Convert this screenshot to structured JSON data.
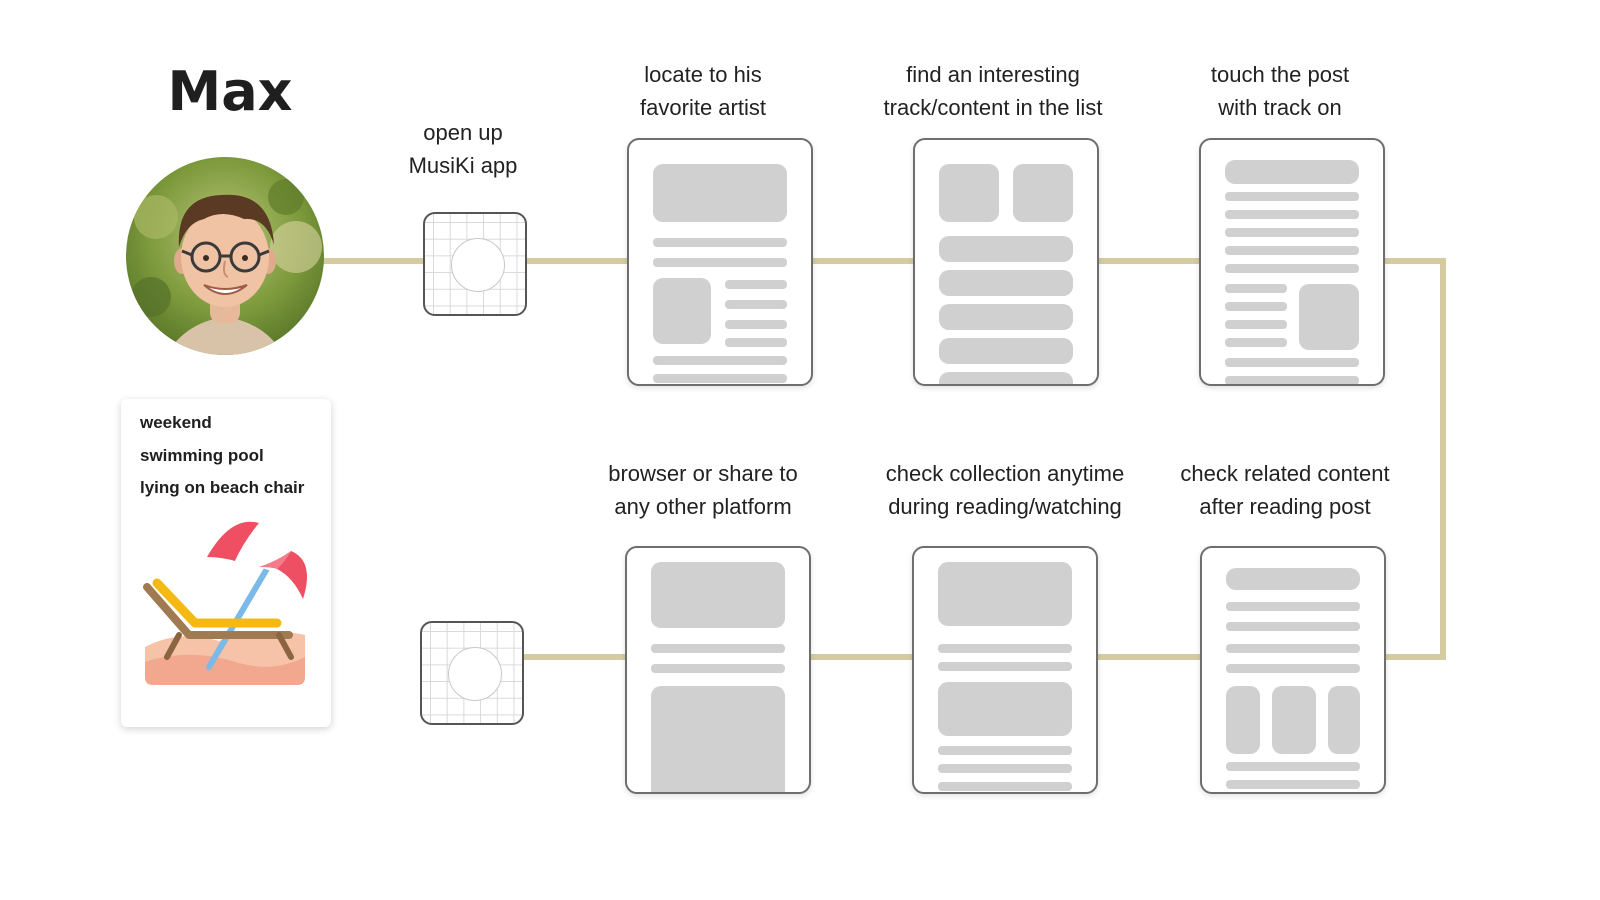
{
  "persona": {
    "name": "Max",
    "scenario": [
      "weekend",
      "swimming pool",
      "lying on beach chair"
    ]
  },
  "steps": {
    "open_app": [
      "open up",
      "MusiKi app"
    ],
    "locate_artist": [
      "locate to his",
      "favorite artist"
    ],
    "find_track": [
      "find an interesting",
      "track/content in the list"
    ],
    "touch_post": [
      "touch the post",
      "with track on"
    ],
    "browser_share": [
      "browser or share to",
      "any other platform"
    ],
    "check_collection": [
      "check collection anytime",
      "during reading/watching"
    ],
    "check_related": [
      "check related content",
      "after reading post"
    ]
  },
  "colors": {
    "connector": "#d4cca0",
    "wireframe_block": "#d0d0d0",
    "wireframe_border": "#6e6e6e"
  }
}
